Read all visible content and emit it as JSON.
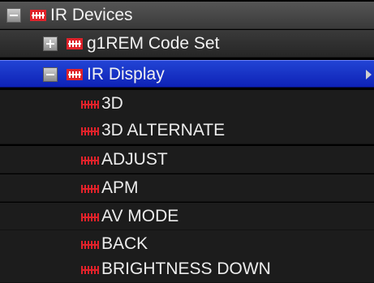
{
  "colors": {
    "background": "#000000",
    "selection": "#1a33cc",
    "icon_red": "#e0222a",
    "text": "#f2f2f2"
  },
  "tree": {
    "root": {
      "label": "IR Devices",
      "state": "expanded",
      "icon": "ir-device-group-icon"
    },
    "code_set": {
      "label": "g1REM Code Set",
      "state": "collapsed",
      "icon": "ir-device-group-icon"
    },
    "display": {
      "label": "IR Display",
      "state": "expanded",
      "selected": true,
      "icon": "ir-device-group-icon",
      "has_submenu_arrow": true
    },
    "commands": [
      {
        "label": "3D",
        "icon": "ir-code-icon"
      },
      {
        "label": "3D ALTERNATE",
        "icon": "ir-code-icon"
      },
      {
        "label": "ADJUST",
        "icon": "ir-code-icon"
      },
      {
        "label": "APM",
        "icon": "ir-code-icon"
      },
      {
        "label": "AV MODE",
        "icon": "ir-code-icon"
      },
      {
        "label": "BACK",
        "icon": "ir-code-icon"
      },
      {
        "label": "BRIGHTNESS DOWN",
        "icon": "ir-code-icon"
      }
    ]
  }
}
